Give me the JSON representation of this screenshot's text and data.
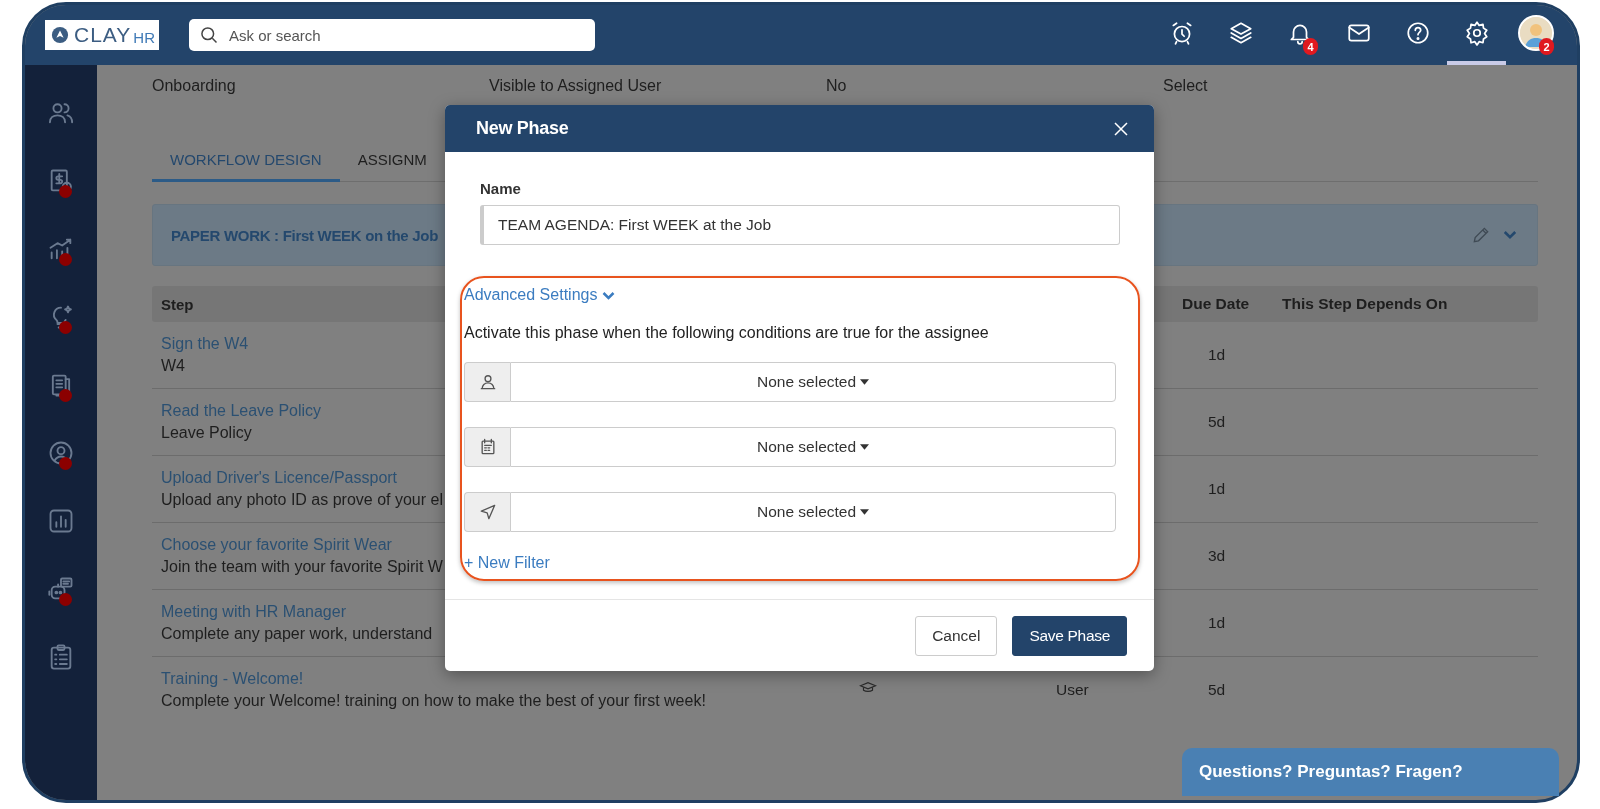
{
  "topbar": {
    "logo": {
      "name": "CLAY",
      "suffix": "HR"
    },
    "search": {
      "placeholder": "Ask or search"
    },
    "toolbar": [
      {
        "kind": "alarm",
        "selected": false
      },
      {
        "kind": "layers",
        "selected": false
      },
      {
        "kind": "bell",
        "selected": false,
        "badge": "4"
      },
      {
        "kind": "mail",
        "selected": false
      },
      {
        "kind": "help",
        "selected": false
      },
      {
        "kind": "settings",
        "selected": true
      },
      {
        "kind": "avatar",
        "selected": false,
        "badge": "2"
      }
    ]
  },
  "sidebar": {
    "items": [
      {
        "kind": "people",
        "alert": false
      },
      {
        "kind": "payroll",
        "alert": true
      },
      {
        "kind": "growth",
        "alert": true
      },
      {
        "kind": "idea",
        "alert": true
      },
      {
        "kind": "documents",
        "alert": true
      },
      {
        "kind": "profile",
        "alert": true
      },
      {
        "kind": "report",
        "alert": false
      },
      {
        "kind": "bot",
        "alert": true
      },
      {
        "kind": "checklist",
        "alert": false
      }
    ]
  },
  "details": [
    {
      "value": "Onboarding"
    },
    {
      "value": "Visible to Assigned User"
    },
    {
      "value": "No"
    },
    {
      "value": "Select"
    }
  ],
  "tabs": [
    {
      "label": "WORKFLOW DESIGN",
      "selected": true
    },
    {
      "label": "ASSIGNM",
      "selected": false
    }
  ],
  "phase": {
    "title": "PAPER WORK : First WEEK on the Job"
  },
  "table": {
    "columns": [
      "Step",
      "Due Date",
      "This Step Depends On"
    ],
    "rows": [
      {
        "title": "Sign the W4",
        "description": "W4",
        "due": "1d"
      },
      {
        "title": "Read the Leave Policy",
        "description": "Leave Policy",
        "due": "5d"
      },
      {
        "title": "Upload Driver's Licence/Passport",
        "description": "Upload any photo ID as prove of your el",
        "due": "1d"
      },
      {
        "title": "Choose your favorite Spirit Wear",
        "description": "Join the team with your favorite Spirit W",
        "due": "3d"
      },
      {
        "title": "Meeting with HR Manager",
        "description": "Complete any paper work, understand",
        "due": "1d"
      },
      {
        "title": "Training - Welcome!",
        "description": "Complete your Welcome! training on how to make the best of your first week!",
        "due": "5d",
        "type_icon": true,
        "assignee": "User"
      }
    ]
  },
  "modal": {
    "title": "New Phase",
    "name_label": "Name",
    "name_value": "TEAM AGENDA: First WEEK at the Job",
    "advanced": {
      "label": "Advanced Settings",
      "expanded": true
    },
    "description": "Activate this phase when the following conditions are true for the assignee",
    "filters": [
      {
        "kind": "user",
        "value": "None selected"
      },
      {
        "kind": "calendar",
        "value": "None selected"
      },
      {
        "kind": "location",
        "value": "None selected"
      }
    ],
    "new_filter": "+ New Filter",
    "buttons": [
      {
        "label": "Cancel",
        "kind": "secondary"
      },
      {
        "label": "Save Phase",
        "kind": "primary"
      }
    ]
  },
  "chat": {
    "label": "Questions? Preguntas? Fragen?"
  }
}
